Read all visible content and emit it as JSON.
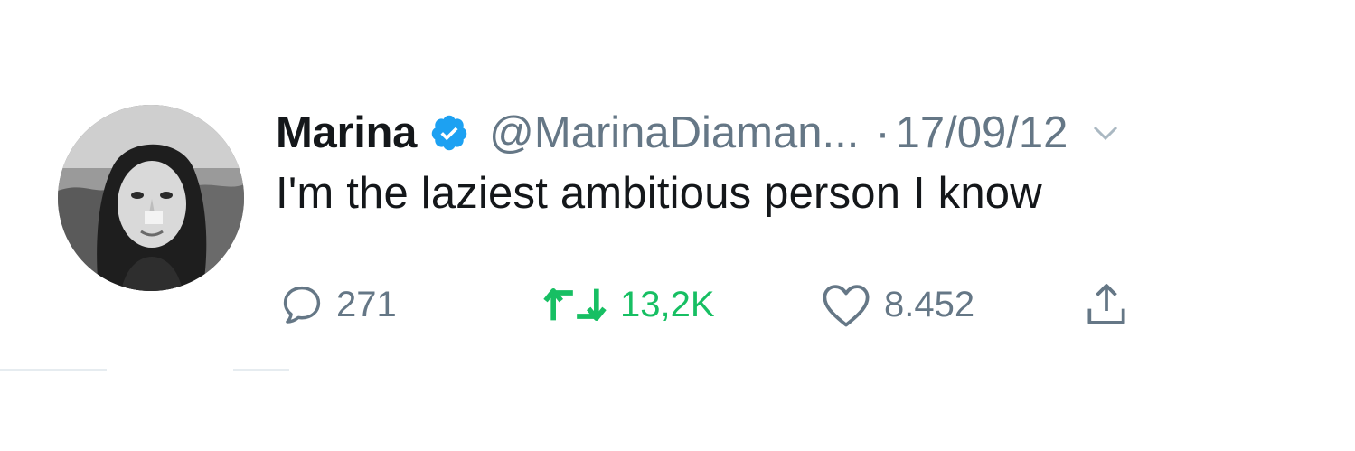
{
  "tweet": {
    "author_name": "Marina",
    "handle": "@MarinaDiaman...",
    "separator": "·",
    "date": "17/09/12",
    "text": "I'm the laziest ambitious person I know",
    "replies": "271",
    "retweets": "13,2K",
    "likes": "8.452"
  },
  "icons": {
    "verified": "verified-badge-icon",
    "menu": "chevron-down-icon",
    "reply": "reply-bubble-icon",
    "retweet": "retweet-icon",
    "like": "heart-icon",
    "share": "share-upload-icon"
  },
  "colors": {
    "text_primary": "#14171a",
    "text_secondary": "#657786",
    "verified_blue": "#1da1f2",
    "retweet_green": "#17bf63"
  }
}
